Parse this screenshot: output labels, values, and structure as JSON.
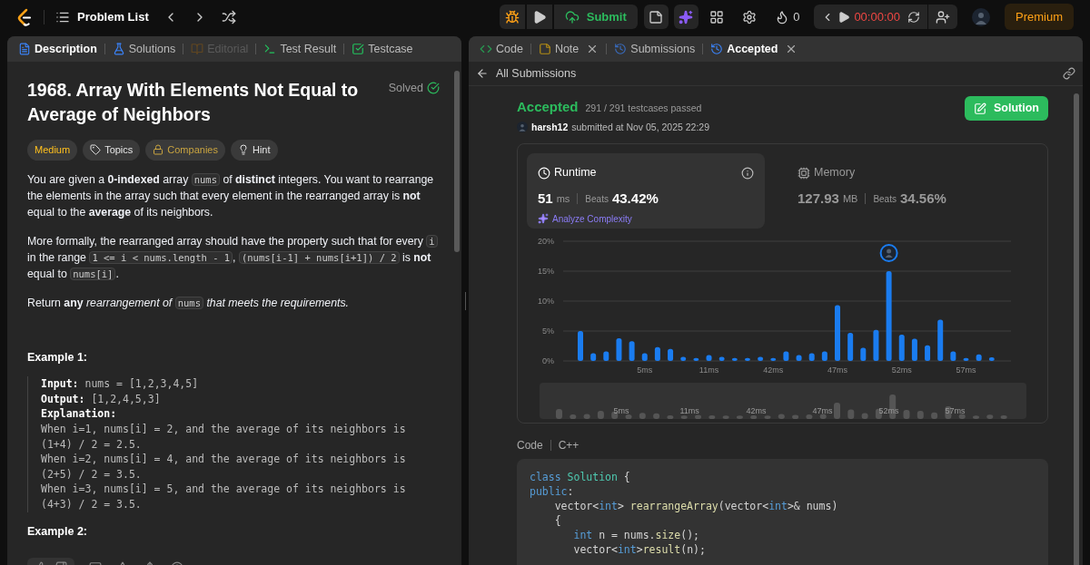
{
  "topbar": {
    "problem_list": "Problem List",
    "submit": "Submit",
    "streak": "0",
    "timer": "00:00:00",
    "premium": "Premium"
  },
  "left_tabs": [
    {
      "label": "Description",
      "selected": true,
      "disabled": false
    },
    {
      "label": "Solutions",
      "selected": false,
      "disabled": false
    },
    {
      "label": "Editorial",
      "selected": false,
      "disabled": true
    },
    {
      "label": "Test Result",
      "selected": false,
      "disabled": false
    },
    {
      "label": "Testcase",
      "selected": false,
      "disabled": false
    }
  ],
  "problem": {
    "title": "1968. Array With Elements Not Equal to Average of Neighbors",
    "status": "Solved",
    "tags": [
      {
        "label": "Medium",
        "kind": "difficulty"
      },
      {
        "label": "Topics",
        "kind": "topics"
      },
      {
        "label": "Companies",
        "kind": "companies"
      },
      {
        "label": "Hint",
        "kind": "hint"
      }
    ],
    "paragraphs": [
      [
        {
          "kind": "text",
          "text": "You are given a **0-indexed** array "
        },
        {
          "kind": "code",
          "text": "nums"
        },
        {
          "kind": "text",
          "text": " of **distinct** integers. You want to rearrange the elements in the array such that every element in the rearranged array is **not** equal to the **average** of its neighbors."
        }
      ],
      [
        {
          "kind": "text",
          "text": "More formally, the rearranged array should have the property such that for every "
        },
        {
          "kind": "code",
          "text": "i"
        },
        {
          "kind": "text",
          "text": " in the range "
        },
        {
          "kind": "code",
          "text": "1 <= i < nums.length - 1"
        },
        {
          "kind": "text",
          "text": ", "
        },
        {
          "kind": "code",
          "text": "(nums[i-1] + nums[i+1]) / 2"
        },
        {
          "kind": "text",
          "text": " is **not** equal to "
        },
        {
          "kind": "code",
          "text": "nums[i]"
        },
        {
          "kind": "text",
          "text": "."
        }
      ],
      [
        {
          "kind": "text",
          "text": "Return **any** *rearrangement of* "
        },
        {
          "kind": "code",
          "text": "nums"
        },
        {
          "kind": "text",
          "text": " *that meets the requirements.*"
        }
      ]
    ],
    "examples": [
      {
        "title": "Example 1:",
        "lines": [
          "**Input:** nums = [1,2,3,4,5]",
          "**Output:** [1,2,4,5,3]",
          "**Explanation:**",
          "When i=1, nums[i] = 2, and the average of its neighbors is (1+4) / 2 = 2.5.",
          "When i=2, nums[i] = 4, and the average of its neighbors is (2+5) / 2 = 3.5.",
          "When i=3, nums[i] = 5, and the average of its neighbors is (4+3) / 2 = 3.5."
        ]
      },
      {
        "title": "Example 2:"
      }
    ]
  },
  "right_tabs": [
    {
      "label": "Code",
      "selected": false,
      "closable": false
    },
    {
      "label": "Note",
      "selected": false,
      "closable": true
    },
    {
      "label": "Submissions",
      "selected": false,
      "closable": false
    },
    {
      "label": "Accepted",
      "selected": true,
      "closable": true
    }
  ],
  "all_submissions": "All Submissions",
  "submission": {
    "status": "Accepted",
    "testcases": "291 / 291 testcases passed",
    "user": "harsh12",
    "submitted": "submitted at Nov 05, 2025 22:29",
    "solution_button": "Solution"
  },
  "stats": [
    {
      "label": "Runtime",
      "value": "51",
      "unit": "ms",
      "beats_label": "Beats",
      "beats": "43.42%",
      "selected": true
    },
    {
      "label": "Memory",
      "value": "127.93",
      "unit": "MB",
      "beats_label": "Beats",
      "beats": "34.56%",
      "selected": false
    }
  ],
  "analyze": "Analyze Complexity",
  "chart_data": {
    "type": "bar",
    "ylim": [
      0,
      20
    ],
    "yticks": [
      {
        "value": 0,
        "label": "0%"
      },
      {
        "value": 5,
        "label": "5%"
      },
      {
        "value": 10,
        "label": "10%"
      },
      {
        "value": 15,
        "label": "15%"
      },
      {
        "value": 20,
        "label": "20%"
      }
    ],
    "grid": true,
    "categories": [
      null,
      null,
      null,
      null,
      null,
      "5ms",
      null,
      null,
      null,
      null,
      "11ms",
      null,
      null,
      null,
      null,
      "42ms",
      null,
      null,
      null,
      null,
      "47ms",
      null,
      null,
      null,
      null,
      "52ms",
      null,
      null,
      null,
      null,
      "57ms",
      null,
      null
    ],
    "values": [
      5,
      1.3,
      1.6,
      3.8,
      3.3,
      1.3,
      2.3,
      2,
      0.7,
      0.5,
      1,
      0.7,
      0.5,
      0.5,
      0.7,
      0.5,
      1.6,
      1,
      1.3,
      1.6,
      9.3,
      4.7,
      2.2,
      5.2,
      15,
      4.4,
      3.7,
      2.6,
      6.9,
      1.6,
      0.5,
      1.1,
      0.6
    ]
  },
  "navigator_labels": [
    "5ms",
    "11ms",
    "42ms",
    "47ms",
    "52ms",
    "57ms"
  ],
  "code": {
    "label": "Code",
    "language": "C++",
    "lines": [
      [
        {
          "t": "class ",
          "kind": "keyword"
        },
        {
          "t": "Solution",
          "kind": "type"
        },
        {
          "t": " {",
          "kind": "plain"
        }
      ],
      [
        {
          "t": "public",
          "kind": "keyword"
        },
        {
          "t": ":",
          "kind": "plain"
        }
      ],
      [
        {
          "t": "    vector<",
          "kind": "plain"
        },
        {
          "t": "int",
          "kind": "keyword"
        },
        {
          "t": "> ",
          "kind": "plain"
        },
        {
          "t": "rearrangeArray",
          "kind": "function"
        },
        {
          "t": "(vector<",
          "kind": "plain"
        },
        {
          "t": "int",
          "kind": "keyword"
        },
        {
          "t": ">& nums)",
          "kind": "plain"
        }
      ],
      [
        {
          "t": "    {",
          "kind": "plain"
        }
      ],
      [
        {
          "t": "       int",
          "kind": "keyword"
        },
        {
          "t": " n = nums.",
          "kind": "plain"
        },
        {
          "t": "size",
          "kind": "function"
        },
        {
          "t": "();",
          "kind": "plain"
        }
      ],
      [
        {
          "t": "       vector<",
          "kind": "plain"
        },
        {
          "t": "int",
          "kind": "keyword"
        },
        {
          "t": ">",
          "kind": "plain"
        },
        {
          "t": "result",
          "kind": "function"
        },
        {
          "t": "(n);",
          "kind": "plain"
        }
      ]
    ]
  }
}
